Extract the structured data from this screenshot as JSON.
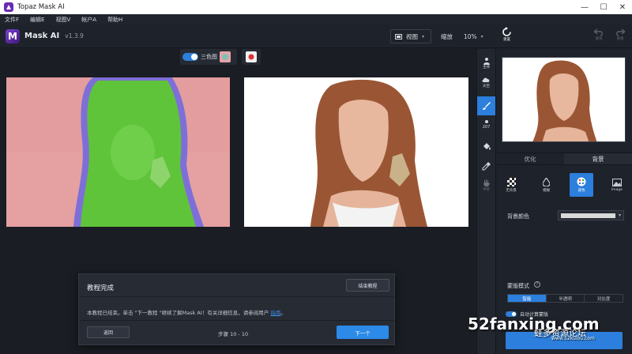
{
  "window": {
    "title": "Topaz Mask AI",
    "controls": [
      "—",
      "☐",
      "✕"
    ]
  },
  "menu": {
    "items": [
      "文件F",
      "编辑E",
      "视图V",
      "帐户A",
      "帮助H"
    ]
  },
  "app": {
    "name": "Mask AI",
    "version": "v1.3.9"
  },
  "toolbar": {
    "view_label": "视图",
    "zoom_label": "缩放",
    "zoom_value": "10%"
  },
  "canvas": {
    "tricolor_label": "三色图",
    "tricolor_enabled": true
  },
  "tools": {
    "items": [
      {
        "label": "主体",
        "icon": "person-icon"
      },
      {
        "label": "天空",
        "icon": "sky-icon"
      },
      {
        "label": "",
        "icon": "brush-icon",
        "active": true
      },
      {
        "label": "207",
        "icon": "brush-size-icon"
      },
      {
        "label": "",
        "icon": "fill-icon"
      },
      {
        "label": "",
        "icon": "eyedropper-icon"
      },
      {
        "label": "平移",
        "icon": "hand-icon"
      }
    ]
  },
  "right_panel": {
    "reset_label": "重置",
    "undo_label": "撤销",
    "redo_label": "重做",
    "tabs": [
      "优化",
      "背景"
    ],
    "active_tab": 1,
    "bg_options": [
      {
        "label": "无背景",
        "icon": "checker-icon"
      },
      {
        "label": "模糊",
        "icon": "drop-icon"
      },
      {
        "label": "颜色",
        "icon": "palette-icon"
      },
      {
        "label": "Image",
        "icon": "image-icon"
      }
    ],
    "active_bg_option": 2,
    "bg_color_label": "背景颜色",
    "bg_color_value": "#d9d9d9",
    "mask_mode_label": "蒙版模式",
    "modes": [
      "智能",
      "半透明",
      "对比度"
    ],
    "active_mode": 0,
    "auto_label": "自动计算蒙版"
  },
  "dialog": {
    "title": "教程完成",
    "end_button": "结束教程",
    "text_before": "本教程已结束。单击 \"下一教程 \"继续了解Mask AI！有关详细信息，请参阅用户",
    "link": "指南",
    "text_after": "。",
    "back_button": "返回",
    "step": "步骤 10 - 10",
    "next_button": "下一个"
  },
  "watermark": {
    "main": "52fanxing.com",
    "cn": "蛙多资源论坛",
    "sub": "www.52kuibu.com"
  },
  "colors": {
    "accent": "#2c7fdc",
    "mask_green": "#5fc43a",
    "mask_red": "#e39d9f",
    "mask_border": "#7e6fd8"
  }
}
